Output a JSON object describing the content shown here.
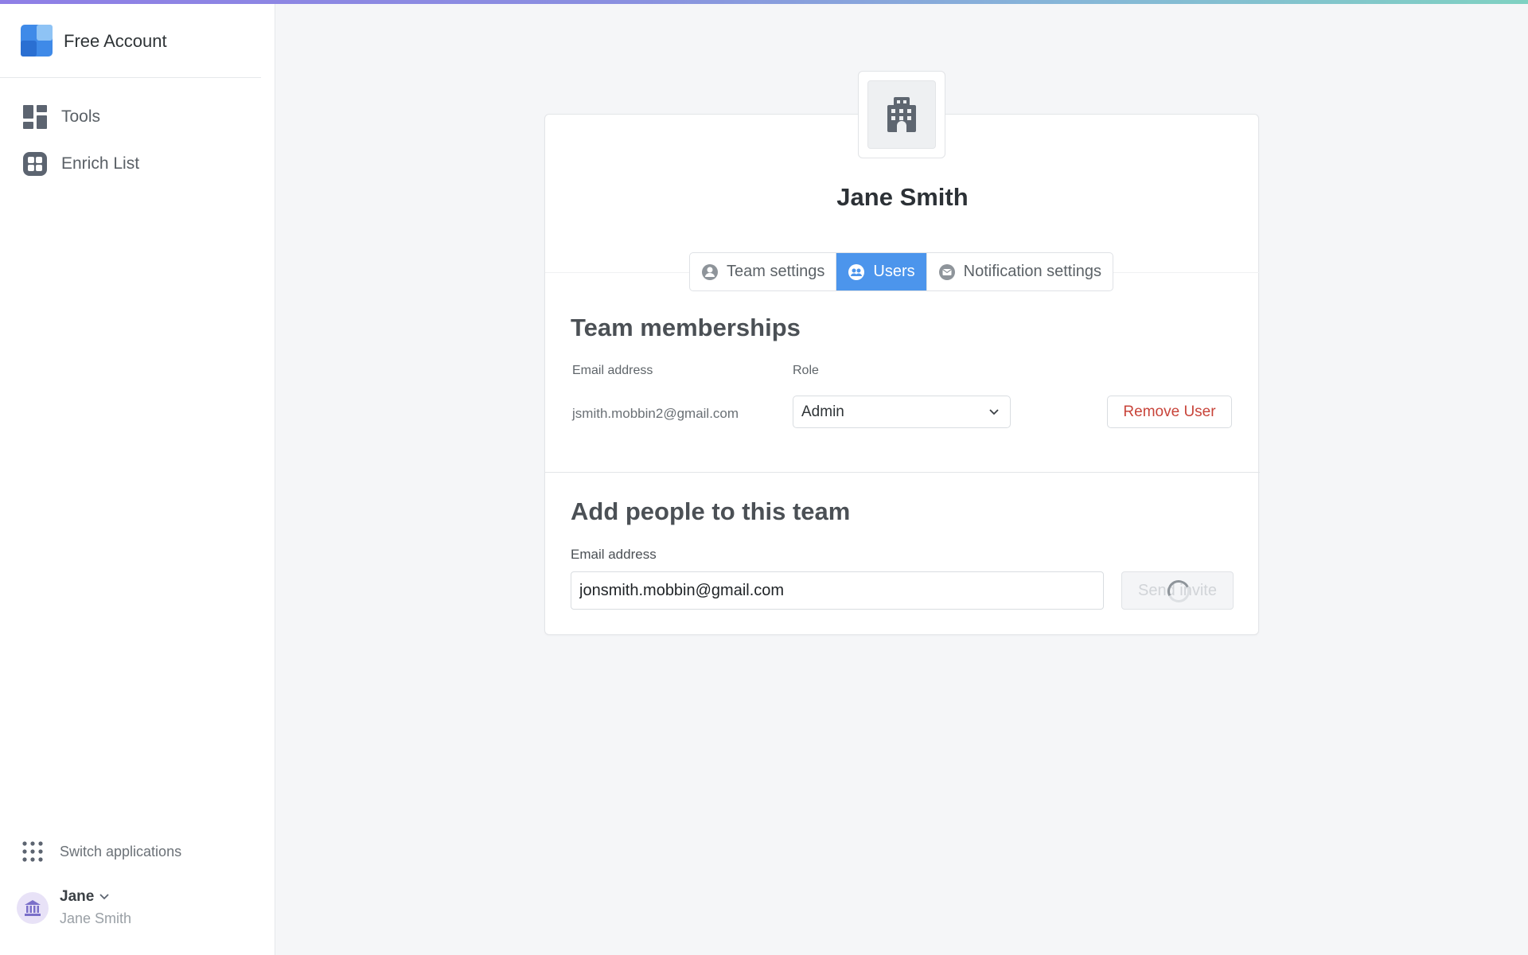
{
  "sidebar": {
    "brand_name": "Free Account",
    "nav": [
      {
        "label": "Tools",
        "icon": "grid-tools-icon"
      },
      {
        "label": "Enrich List",
        "icon": "enrich-list-icon"
      }
    ],
    "switch_apps_label": "Switch applications",
    "user": {
      "name": "Jane",
      "subtitle": "Jane Smith"
    }
  },
  "card": {
    "title": "Jane Smith",
    "tabs": [
      {
        "label": "Team settings",
        "icon": "person-icon",
        "active": false
      },
      {
        "label": "Users",
        "icon": "users-icon",
        "active": true
      },
      {
        "label": "Notification settings",
        "icon": "envelope-icon",
        "active": false
      }
    ],
    "memberships": {
      "title": "Team memberships",
      "col_email": "Email address",
      "col_role": "Role",
      "rows": [
        {
          "email": "jsmith.mobbin2@gmail.com",
          "role": "Admin",
          "action": "Remove User"
        }
      ]
    },
    "add_people": {
      "title": "Add people to this team",
      "email_label": "Email address",
      "email_value": "jonsmith.mobbin@gmail.com",
      "send_label": "Send invite"
    }
  },
  "colors": {
    "accent": "#4c95ec",
    "danger": "#c8443a",
    "gradient_start": "#8f7fe6",
    "gradient_end": "#7fd1c2"
  }
}
